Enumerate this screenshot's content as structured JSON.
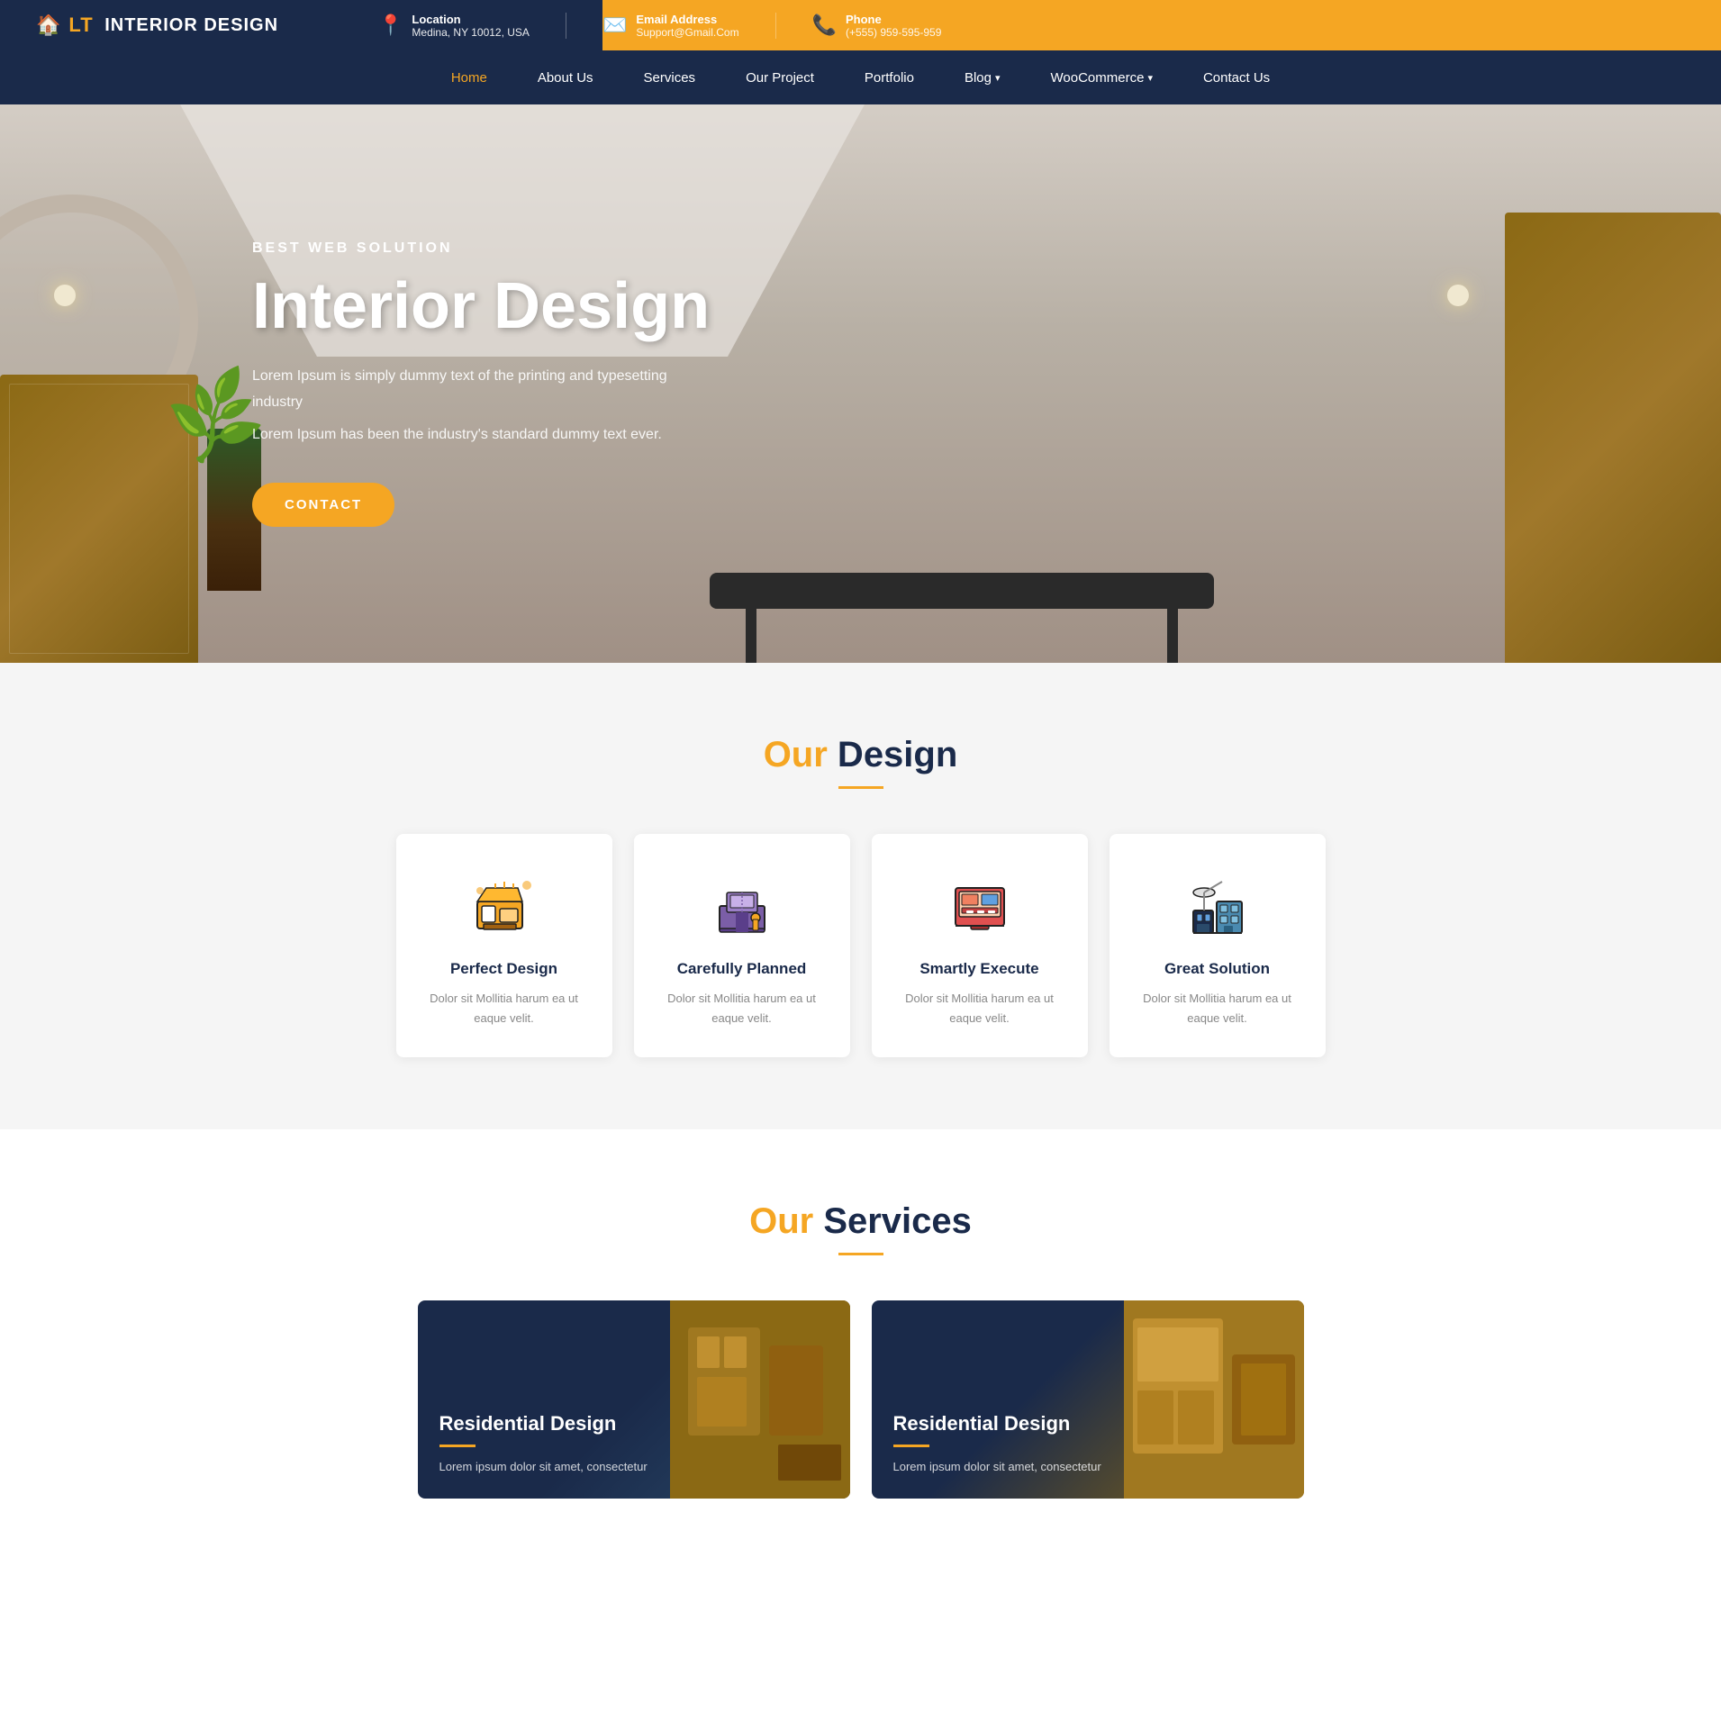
{
  "brand": {
    "lt": "LT",
    "name": "INTERIOR DESIGN",
    "icon": "🏠"
  },
  "topbar": {
    "location_label": "Location",
    "location_value": "Medina, NY 10012, USA",
    "email_label": "Email Address",
    "email_value": "Support@Gmail.Com",
    "phone_label": "Phone",
    "phone_value": "(+555) 959-595-959"
  },
  "nav": {
    "items": [
      {
        "label": "Home",
        "active": true,
        "has_dropdown": false
      },
      {
        "label": "About Us",
        "active": false,
        "has_dropdown": false
      },
      {
        "label": "Services",
        "active": false,
        "has_dropdown": false
      },
      {
        "label": "Our Project",
        "active": false,
        "has_dropdown": false
      },
      {
        "label": "Portfolio",
        "active": false,
        "has_dropdown": false
      },
      {
        "label": "Blog",
        "active": false,
        "has_dropdown": true
      },
      {
        "label": "WooCommerce",
        "active": false,
        "has_dropdown": true
      },
      {
        "label": "Contact Us",
        "active": false,
        "has_dropdown": false
      }
    ]
  },
  "hero": {
    "subtitle": "BEST WEB SOLUTION",
    "title": "Interior Design",
    "desc1": "Lorem Ipsum is simply dummy text of the printing and typesetting industry",
    "desc2": "Lorem Ipsum has been the industry's standard dummy text ever.",
    "cta_label": "CONTACT"
  },
  "design_section": {
    "title_our": "Our",
    "title_main": " Design",
    "cards": [
      {
        "icon": "🛋️",
        "title": "Perfect Design",
        "desc": "Dolor sit Mollitia harum ea ut eaque velit.",
        "icon_name": "interior-icon"
      },
      {
        "icon": "🖥️",
        "title": "Carefully Planned",
        "desc": "Dolor sit Mollitia harum ea ut eaque velit.",
        "icon_name": "desk-icon"
      },
      {
        "icon": "🔧",
        "title": "Smartly Execute",
        "desc": "Dolor sit Mollitia harum ea ut eaque velit.",
        "icon_name": "execute-icon"
      },
      {
        "icon": "🏗️",
        "title": "Great Solution",
        "desc": "Dolor sit Mollitia harum ea ut eaque velit.",
        "icon_name": "solution-icon"
      }
    ]
  },
  "services_section": {
    "title_our": "Our",
    "title_main": " Services",
    "cards": [
      {
        "title": "Residential Design",
        "desc": "Lorem ipsum dolor sit amet, consectetur"
      },
      {
        "title": "Residential Design",
        "desc": "Lorem ipsum dolor sit amet, consectetur"
      }
    ]
  },
  "colors": {
    "orange": "#f5a623",
    "dark_blue": "#1a2a4a",
    "white": "#ffffff",
    "light_gray": "#f5f5f5"
  }
}
